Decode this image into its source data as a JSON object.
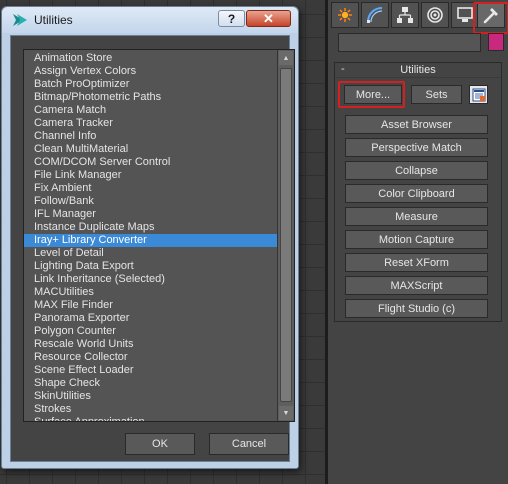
{
  "dialog": {
    "title": "Utilities",
    "help_label": "?",
    "close_label": "✕",
    "items": [
      "Animation Store",
      "Assign Vertex Colors",
      "Batch ProOptimizer",
      "Bitmap/Photometric Paths",
      "Camera Match",
      "Camera Tracker",
      "Channel Info",
      "Clean MultiMaterial",
      "COM/DCOM Server Control",
      "File Link Manager",
      "Fix Ambient",
      "Follow/Bank",
      "IFL Manager",
      "Instance Duplicate Maps",
      "Iray+ Library Converter",
      "Level of Detail",
      "Lighting Data Export",
      "Link Inheritance (Selected)",
      "MACUtilities",
      "MAX File Finder",
      "Panorama Exporter",
      "Polygon Counter",
      "Rescale World Units",
      "Resource Collector",
      "Scene Effect Loader",
      "Shape Check",
      "SkinUtilities",
      "Strokes",
      "Surface Approximation"
    ],
    "selected_item": "Iray+ Library Converter",
    "ok_label": "OK",
    "cancel_label": "Cancel"
  },
  "command_panel": {
    "tabs": [
      "create-icon",
      "modify-icon",
      "hierarchy-icon",
      "motion-icon",
      "display-icon",
      "utilities-icon"
    ],
    "active_tab": "utilities-icon",
    "rollout": {
      "collapse_symbol": "-",
      "title": "Utilities",
      "more_label": "More...",
      "sets_label": "Sets",
      "buttons": [
        "Asset Browser",
        "Perspective Match",
        "Collapse",
        "Color Clipboard",
        "Measure",
        "Motion Capture",
        "Reset XForm",
        "MAXScript",
        "Flight Studio (c)"
      ]
    },
    "swatch_color": "#c8287e",
    "highlight_color": "#d42020"
  }
}
